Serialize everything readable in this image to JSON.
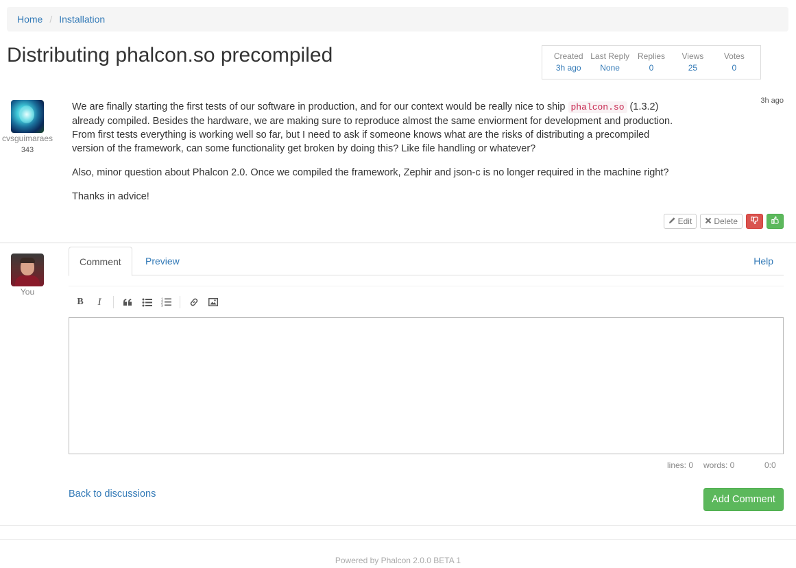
{
  "breadcrumb": {
    "home": "Home",
    "category": "Installation"
  },
  "title": "Distributing phalcon.so precompiled",
  "stats": [
    {
      "label": "Created",
      "value": "3h ago"
    },
    {
      "label": "Last Reply",
      "value": "None"
    },
    {
      "label": "Replies",
      "value": "0"
    },
    {
      "label": "Views",
      "value": "25"
    },
    {
      "label": "Votes",
      "value": "0"
    }
  ],
  "post": {
    "author": "cvsguimaraes",
    "reputation": "343",
    "time": "3h ago",
    "p1_before": "We are finally starting the first tests of our software in production, and for our context would be really nice to ship ",
    "p1_code": "phalcon.so",
    "p1_after": " (1.3.2) already compiled. Besides the hardware, we are making sure to reproduce almost the same enviorment for development and production. From first tests everything is working well so far, but I need to ask if someone knows what are the risks of distributing a precompiled version of the framework, can some functionality get broken by doing this? Like file handling or whatever?",
    "p2": "Also, minor question about Phalcon 2.0. Once we compiled the framework, Zephir and json-c is no longer required in the machine right?",
    "p3": "Thanks in advice!",
    "actions": {
      "edit": "Edit",
      "delete": "Delete"
    }
  },
  "comment": {
    "user_label": "You",
    "tabs": {
      "comment": "Comment",
      "preview": "Preview",
      "help": "Help"
    },
    "editor_value": "",
    "status": {
      "lines": "lines: 0",
      "words": "words: 0",
      "cursor": "0:0"
    },
    "back_link": "Back to discussions",
    "submit": "Add Comment"
  },
  "footer": "Powered by Phalcon 2.0.0 BETA 1",
  "colors": {
    "link": "#337ab7",
    "success": "#5cb85c",
    "danger": "#d9534f"
  }
}
